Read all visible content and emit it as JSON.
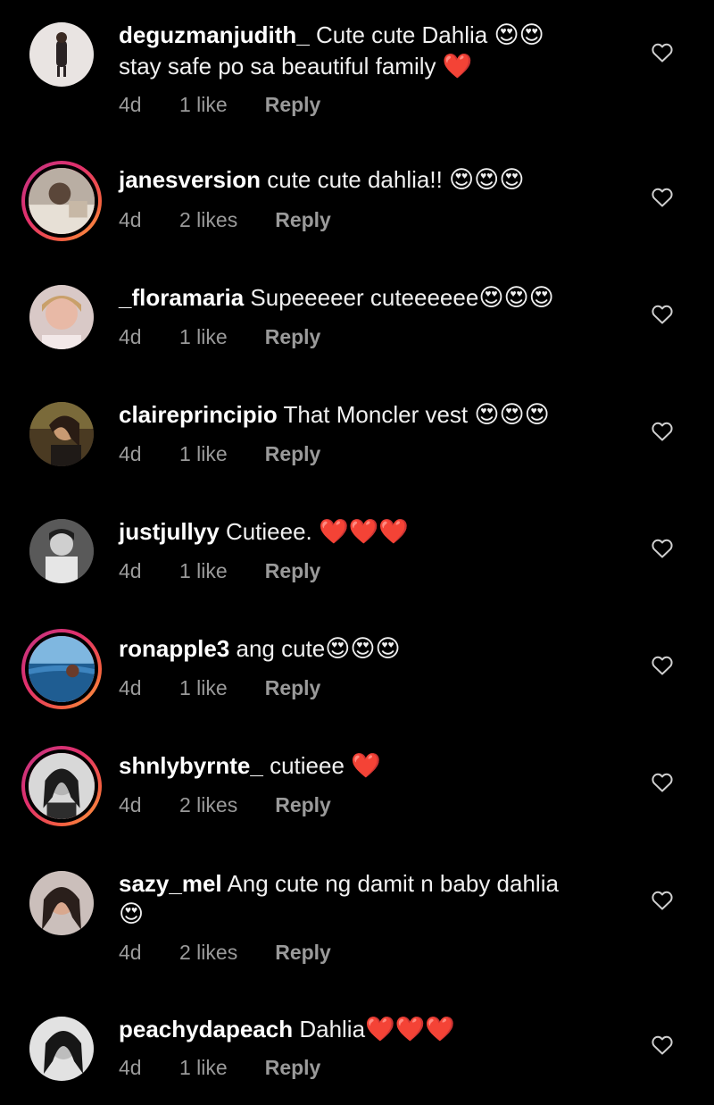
{
  "comments": [
    {
      "username": "deguzmanjudith_",
      "text": "Cute cute Dahlia",
      "emoji_inline": "😍😍",
      "text_line2": "stay safe po sa beautiful family",
      "emoji_line2": "❤️",
      "time": "4d",
      "likes": "1 like",
      "reply": "Reply",
      "avatar_icon": "profile-photo-icon",
      "story_ring": false
    },
    {
      "username": "janesversion",
      "text": "cute cute dahlia!!",
      "emoji_inline": "😍😍😍",
      "time": "4d",
      "likes": "2 likes",
      "reply": "Reply",
      "avatar_icon": "profile-photo-icon",
      "story_ring": true
    },
    {
      "username": "_floramaria",
      "text": "Supeeeeer cuteeeeee",
      "emoji_inline": "😍😍😍",
      "time": "4d",
      "likes": "1 like",
      "reply": "Reply",
      "avatar_icon": "profile-photo-icon",
      "story_ring": false
    },
    {
      "username": "claireprincipio",
      "text": "That Moncler vest",
      "emoji_inline": "😍😍😍",
      "time": "4d",
      "likes": "1 like",
      "reply": "Reply",
      "avatar_icon": "profile-photo-icon",
      "story_ring": false
    },
    {
      "username": "justjullyy",
      "text": "Cutieee.",
      "emoji_inline": "❤️❤️❤️",
      "time": "4d",
      "likes": "1 like",
      "reply": "Reply",
      "avatar_icon": "profile-photo-icon",
      "story_ring": false
    },
    {
      "username": "ronapple3",
      "text": "ang cute",
      "emoji_inline": "😍😍😍",
      "time": "4d",
      "likes": "1 like",
      "reply": "Reply",
      "avatar_icon": "profile-photo-icon",
      "story_ring": true
    },
    {
      "username": "shnlybyrnte_",
      "text": "cutieee",
      "emoji_inline": "❤️",
      "time": "4d",
      "likes": "2 likes",
      "reply": "Reply",
      "avatar_icon": "profile-photo-icon",
      "story_ring": true
    },
    {
      "username": "sazy_mel",
      "text": "Ang cute ng damit n baby dahlia",
      "emoji_line2": "😍",
      "time": "4d",
      "likes": "2 likes",
      "reply": "Reply",
      "avatar_icon": "profile-photo-icon",
      "story_ring": false
    },
    {
      "username": "peachydapeach",
      "text": "Dahlia",
      "emoji_inline": "❤️❤️❤️",
      "time": "4d",
      "likes": "1 like",
      "reply": "Reply",
      "avatar_icon": "profile-photo-icon",
      "story_ring": false
    }
  ],
  "colors": {
    "background": "#000000",
    "text": "#f0f0f0",
    "meta": "#9a9a9a",
    "story_ring_start": "#c13584",
    "story_ring_end": "#fcaf45"
  }
}
